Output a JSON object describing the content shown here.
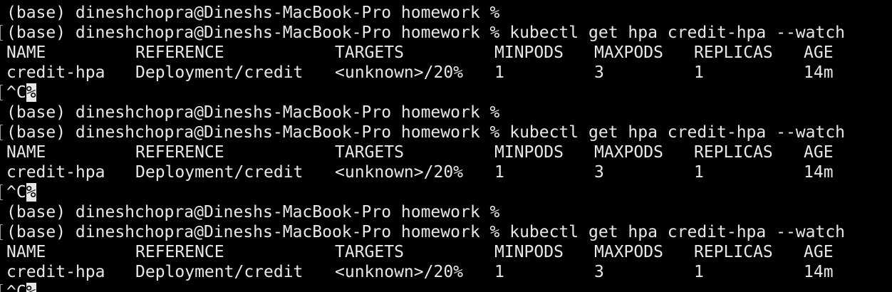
{
  "terminal": {
    "prompt": "(base) dineshchopra@Dineshs-MacBook-Pro homework %",
    "command": "kubectl get hpa credit-hpa --watch",
    "interrupt": "^C",
    "cursor_glyph": "%",
    "table": {
      "headers": [
        "NAME",
        "REFERENCE",
        "TARGETS",
        "MINPODS",
        "MAXPODS",
        "REPLICAS",
        "AGE"
      ],
      "row": [
        "credit-hpa",
        "Deployment/credit",
        "<unknown>/20%",
        "1",
        "3",
        "1",
        "14m"
      ]
    }
  },
  "colors": {
    "background": "#000000",
    "foreground": "#e8e8e8"
  }
}
